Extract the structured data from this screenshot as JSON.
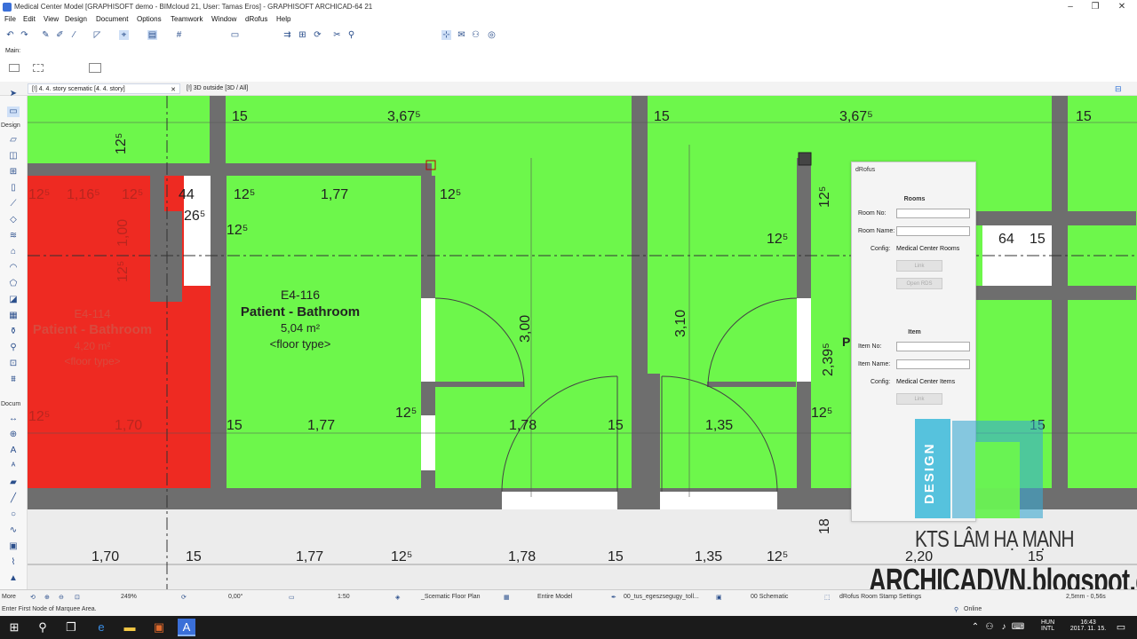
{
  "window": {
    "title": "Medical Center Model [GRAPHISOFT demo - BIMcloud 21, User: Tamas Eros] - GRAPHISOFT ARCHICAD-64 21",
    "minimize": "–",
    "maximize": "❐",
    "close": "✕"
  },
  "menu": [
    "File",
    "Edit",
    "View",
    "Design",
    "Document",
    "Options",
    "Teamwork",
    "Window",
    "dRofus",
    "Help"
  ],
  "subtoolbar": {
    "main_label": "Main:"
  },
  "tabs": [
    {
      "label": "[!] 4. 4. story scematic [4. 4. story]",
      "close": "✕"
    },
    {
      "label": "[!] 3D outside [3D / All]"
    }
  ],
  "toolbox": {
    "design_label": "Design",
    "document_label": "Docum",
    "more_label": "More"
  },
  "plan": {
    "room_left": {
      "number": "E4-114",
      "name": "Patient - Bathroom",
      "area": "4,20 m²",
      "floor": "<floor type>"
    },
    "room_center": {
      "number": "E4-116",
      "name": "Patient - Bathroom",
      "area": "5,04 m²",
      "floor": "<floor type>"
    },
    "room_right_partial": "P",
    "dims": {
      "top1": "15",
      "top2": "3,67⁵",
      "top3": "15",
      "top4": "3,67⁵",
      "top5": "15",
      "v125a": "12⁵",
      "r1a": "12⁵",
      "r1b": "1,16⁵",
      "r1c": "12⁵",
      "d44": "44",
      "d265": "26⁵",
      "d125b": "12⁵",
      "d177a": "1,77",
      "d125c": "12⁵",
      "d125d": "12⁵",
      "v100": "1,00",
      "v125e": "12⁵",
      "v300": "3,00",
      "v310": "3,10",
      "v2395": "2,39⁵",
      "v125f": "12⁵",
      "d125g": "12⁵",
      "d64": "64",
      "d15r": "15",
      "m125": "12⁵",
      "m170": "1,70",
      "m15": "15",
      "m177": "1,77",
      "m125b": "12⁵",
      "m178": "1,78",
      "m15b": "15",
      "m135": "1,35",
      "m125c": "12⁵",
      "m15c": "15",
      "b170": "1,70",
      "b15": "15",
      "b177": "1,77",
      "b125": "12⁵",
      "b178": "1,78",
      "b15b": "15",
      "b135": "1,35",
      "b125b": "12⁵",
      "b220": "2,20",
      "b15c": "15",
      "v18": "18"
    }
  },
  "drofus": {
    "title": "dRofus",
    "rooms_header": "Rooms",
    "room_no_label": "Room No:",
    "room_name_label": "Room Name:",
    "config_label": "Config:",
    "rooms_config": "Medical Center Rooms",
    "link_button": "Link",
    "open_rds_button": "Open RDS",
    "item_header": "Item",
    "item_no_label": "Item No:",
    "item_name_label": "Item Name:",
    "items_config": "Medical Center Items",
    "link_button2": "Link"
  },
  "status": {
    "zoom": "249%",
    "angle": "0,00°",
    "scale": "1:50",
    "layer_combo": "_Scematic Floor Plan",
    "model_view": "Entire Model",
    "pen_set": "00_tus_egeszsegugy_toll...",
    "mvo": "00 Schematic",
    "drofus_status": "dRofus Room Stamp Settings",
    "dim_status": "2,5mm - 0,56s",
    "online": "Online",
    "hint": "Enter First Node of Marquee Area."
  },
  "taskbar": {
    "lang1": "HUN",
    "lang2": "INTL",
    "time": "16:43",
    "date": "2017. 11. 15."
  },
  "watermark": {
    "logo_left": "DESIGN",
    "line1": "KTS LÂM HẠ MẠNH",
    "line2": "ARCHICADVN.blogspot.com"
  },
  "colors": {
    "room_green": "#6df74b",
    "room_red": "#ee2a22",
    "wall_gray": "#6e6e6e",
    "accent_blue": "#2b6fd6"
  }
}
